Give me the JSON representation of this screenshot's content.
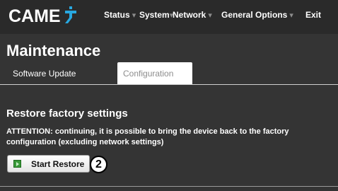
{
  "header": {
    "logo_text": "CAME",
    "nav": [
      {
        "label": "Status",
        "caret": "▾"
      },
      {
        "label": "System",
        "caret": "▾"
      },
      {
        "label": "Network",
        "caret": "▾"
      },
      {
        "label": "General Options",
        "caret": "▾"
      },
      {
        "label": "Exit",
        "caret": ""
      }
    ]
  },
  "main": {
    "title": "Maintenance",
    "tabs": [
      {
        "label": "Software Update",
        "active": false
      },
      {
        "label": "Configuration",
        "active": true
      }
    ],
    "section_heading": "Restore factory settings",
    "attention_text": "ATTENTION: continuing, it is possible to bring the device back to the factory configuration (excluding network settings)",
    "start_restore_label": "Start Restore",
    "callout_number": "2"
  },
  "colors": {
    "background": "#343434",
    "header_bg": "#2a2a2a",
    "logo_accent": "#28a8e0",
    "button_icon": "#3a9a3a"
  }
}
